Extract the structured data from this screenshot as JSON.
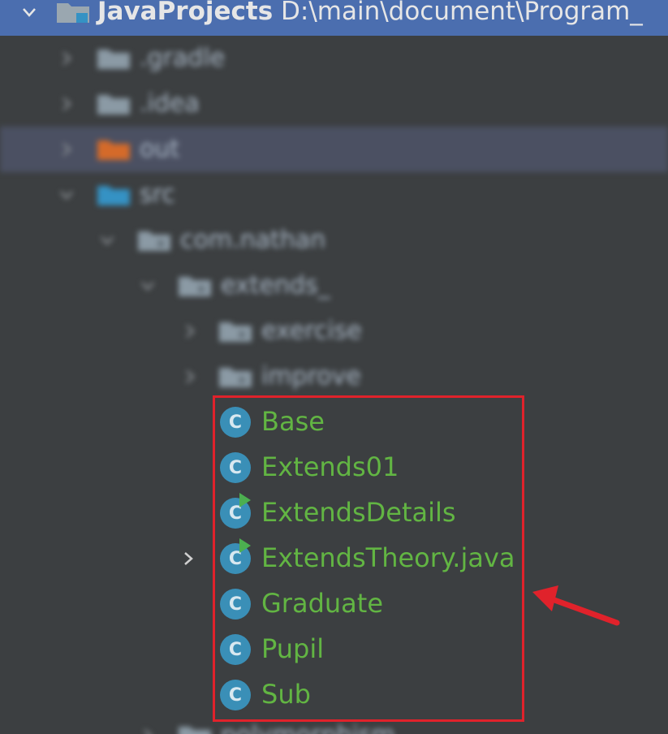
{
  "header": {
    "project_name": "JavaProjects",
    "project_path": "D:\\main\\document\\Program_"
  },
  "tree": {
    "gradle_label": ".gradle",
    "idea_label": ".idea",
    "out_label": "out",
    "src_label": "src",
    "package_label": "com.nathan",
    "extends_label": "extends_",
    "exercise_label": "exercise",
    "improve_label": "improve",
    "polymorphism_label": "polymorphism"
  },
  "classes": {
    "base": "Base",
    "extends01": "Extends01",
    "extends_details": "ExtendsDetails",
    "extends_theory": "ExtendsTheory.java",
    "graduate": "Graduate",
    "pupil": "Pupil",
    "sub": "Sub"
  },
  "icons": {
    "class_icon_letter": "C",
    "chevron": "chevron-icon",
    "folder": "folder-icon"
  },
  "colors": {
    "background": "#3c3f41",
    "header": "#4b6eaf",
    "selection": "#4b5062",
    "class_text": "#62b543",
    "class_icon": "#3a8fb7",
    "highlight": "#e0222b"
  }
}
